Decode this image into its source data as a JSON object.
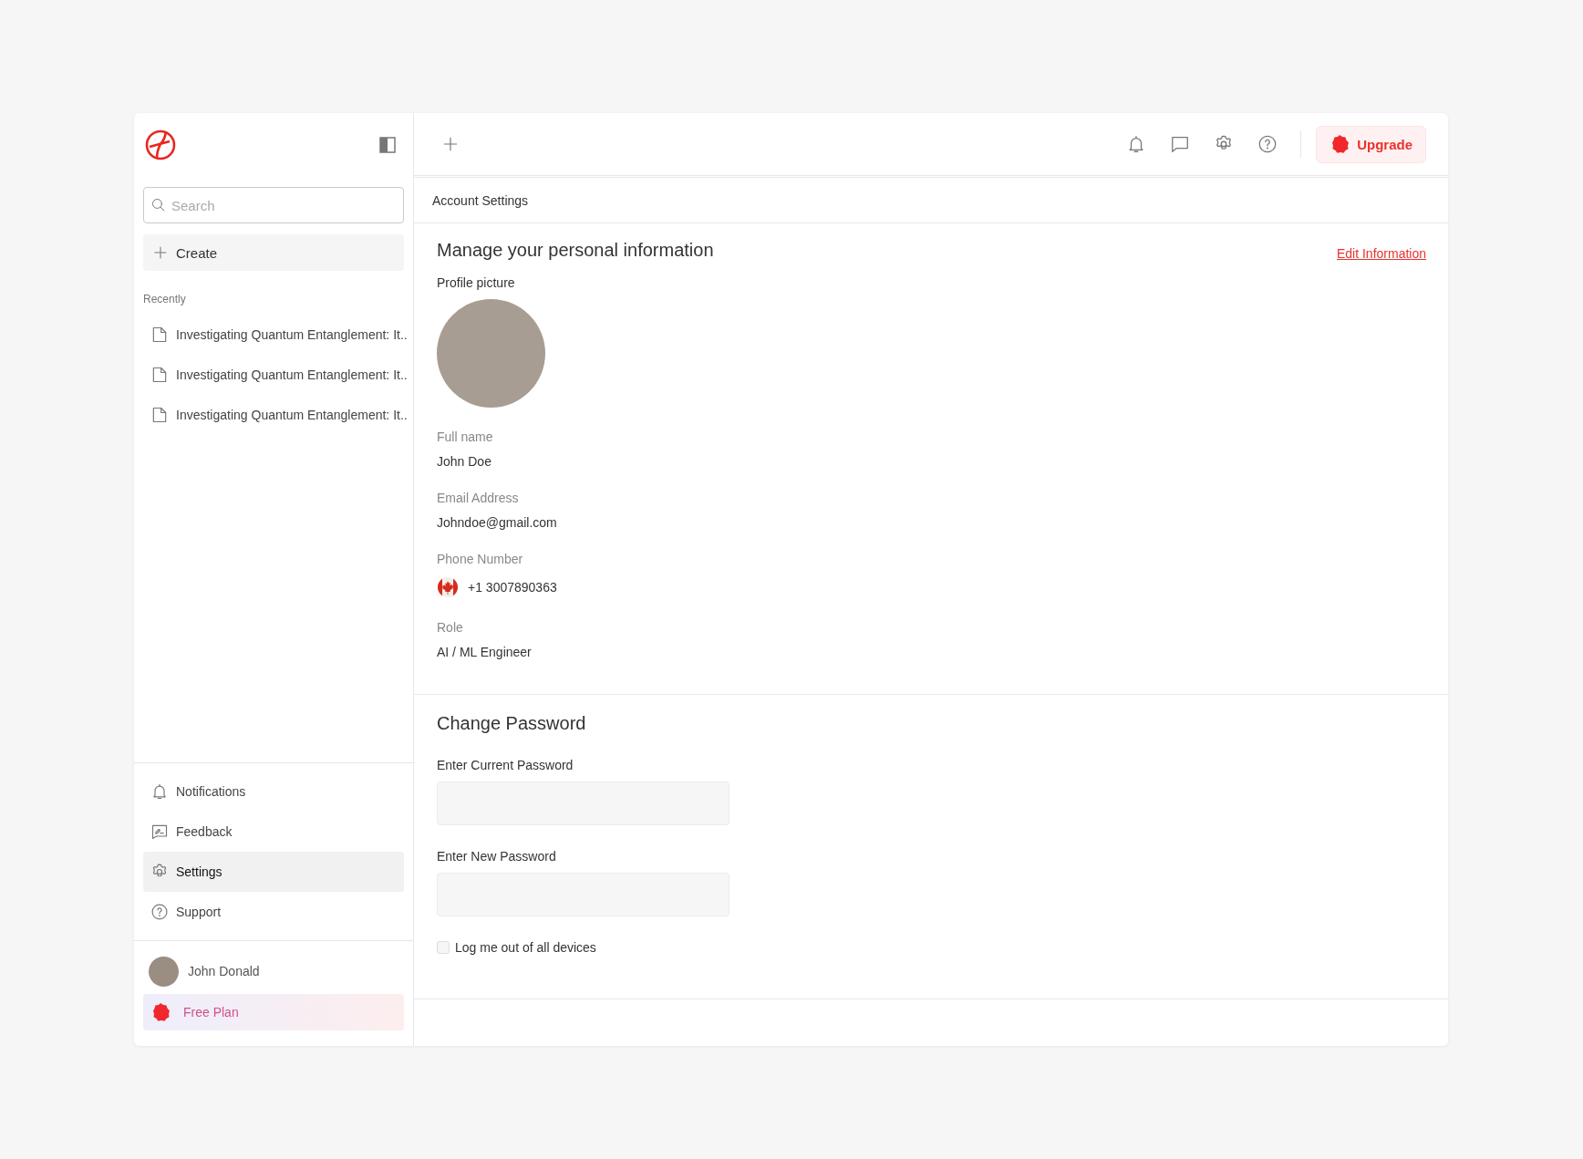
{
  "sidebar": {
    "search": {
      "placeholder": "Search"
    },
    "create_button": "Create",
    "recent_heading": "Recently",
    "recent_items": [
      {
        "title": "Investigating Quantum Entanglement: It.."
      },
      {
        "title": "Investigating Quantum Entanglement: It.."
      },
      {
        "title": "Investigating Quantum Entanglement: It.."
      }
    ],
    "nav_items": [
      {
        "label": "Notifications",
        "kind": "bell",
        "selected": false
      },
      {
        "label": "Feedback",
        "kind": "feedback",
        "selected": false
      },
      {
        "label": "Settings",
        "kind": "gear",
        "selected": true
      },
      {
        "label": "Support",
        "kind": "help",
        "selected": false
      }
    ],
    "user": {
      "name": "John Donald"
    },
    "plan": "Free Plan"
  },
  "top_bar": {
    "upgrade_button": "Upgrade"
  },
  "breadcrumb": "Account Settings",
  "profile": {
    "title": "Manage your personal information",
    "edit_link": "Edit Information",
    "picture_label": "Profile picture",
    "fields": [
      {
        "label": "Full name",
        "value": "John Doe",
        "kind": "text"
      },
      {
        "label": "Email Address",
        "value": "Johndoe@gmail.com",
        "kind": "text"
      },
      {
        "label": "Phone Number",
        "value": "+1 3007890363",
        "kind": "phone"
      },
      {
        "label": "Role",
        "value": "AI / ML Engineer",
        "kind": "text"
      }
    ]
  },
  "password": {
    "title": "Change Password",
    "fields": [
      {
        "label": "Enter Current Password"
      },
      {
        "label": "Enter New  Password"
      }
    ],
    "logout_all": {
      "label": "Log me out of all devices",
      "checked": false
    }
  }
}
